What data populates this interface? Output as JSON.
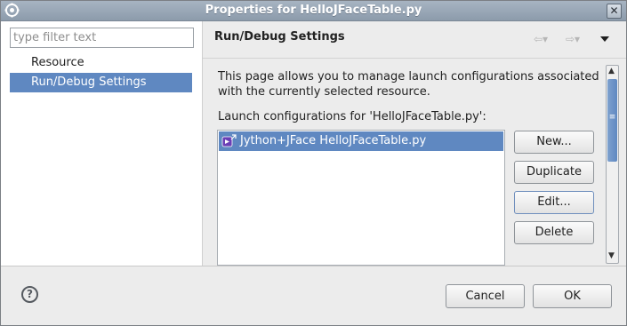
{
  "window": {
    "title": "Properties for HelloJFaceTable.py"
  },
  "filter": {
    "placeholder": "type filter text",
    "value": ""
  },
  "nav": {
    "items": [
      {
        "label": "Resource",
        "selected": false
      },
      {
        "label": "Run/Debug Settings",
        "selected": true
      }
    ]
  },
  "page": {
    "title": "Run/Debug Settings",
    "description": "This page allows you to manage launch configurations associated with the currently selected resource.",
    "list_label": "Launch configurations for 'HelloJFaceTable.py':",
    "configurations": [
      {
        "label": "Jython+JFace HelloJFaceTable.py",
        "icon": "jython-launch-icon",
        "selected": true
      }
    ],
    "buttons": {
      "new": "New...",
      "duplicate": "Duplicate",
      "edit": "Edit...",
      "delete": "Delete"
    }
  },
  "footer": {
    "cancel": "Cancel",
    "ok": "OK"
  },
  "icons": {
    "app": "gear-icon",
    "close": "close-icon",
    "back": "back-arrow-icon",
    "forward": "forward-arrow-icon",
    "menu": "view-menu-icon",
    "help": "help-icon"
  },
  "colors": {
    "selection": "#5f88c1",
    "titlebar": "#97a5b5"
  }
}
